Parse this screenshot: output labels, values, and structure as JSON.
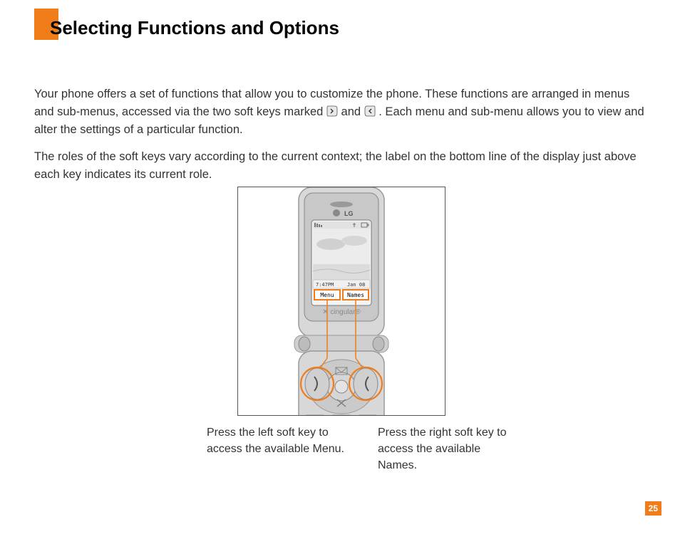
{
  "header": {
    "title": "Selecting Functions and Options"
  },
  "body": {
    "p1a": "Your phone offers a set of functions that allow you to customize the phone. These functions are arranged in menus and sub-menus, accessed via the two soft keys marked ",
    "p1b": " and ",
    "p1c": " . Each menu and sub-menu allows you to view and alter the settings of a particular function.",
    "p2": "The roles of the soft keys vary according to the current context; the label on the bottom line of the display just above each key indicates its current role."
  },
  "phone": {
    "brand": "LG",
    "carrier": "cingular",
    "time": "7:47PM",
    "date": "Jan 08",
    "softkey_left": "Menu",
    "softkey_right": "Names"
  },
  "captions": {
    "left": "Press the left soft key to access the available Menu.",
    "right": "Press the right soft key to access the available Names."
  },
  "page_number": "25"
}
